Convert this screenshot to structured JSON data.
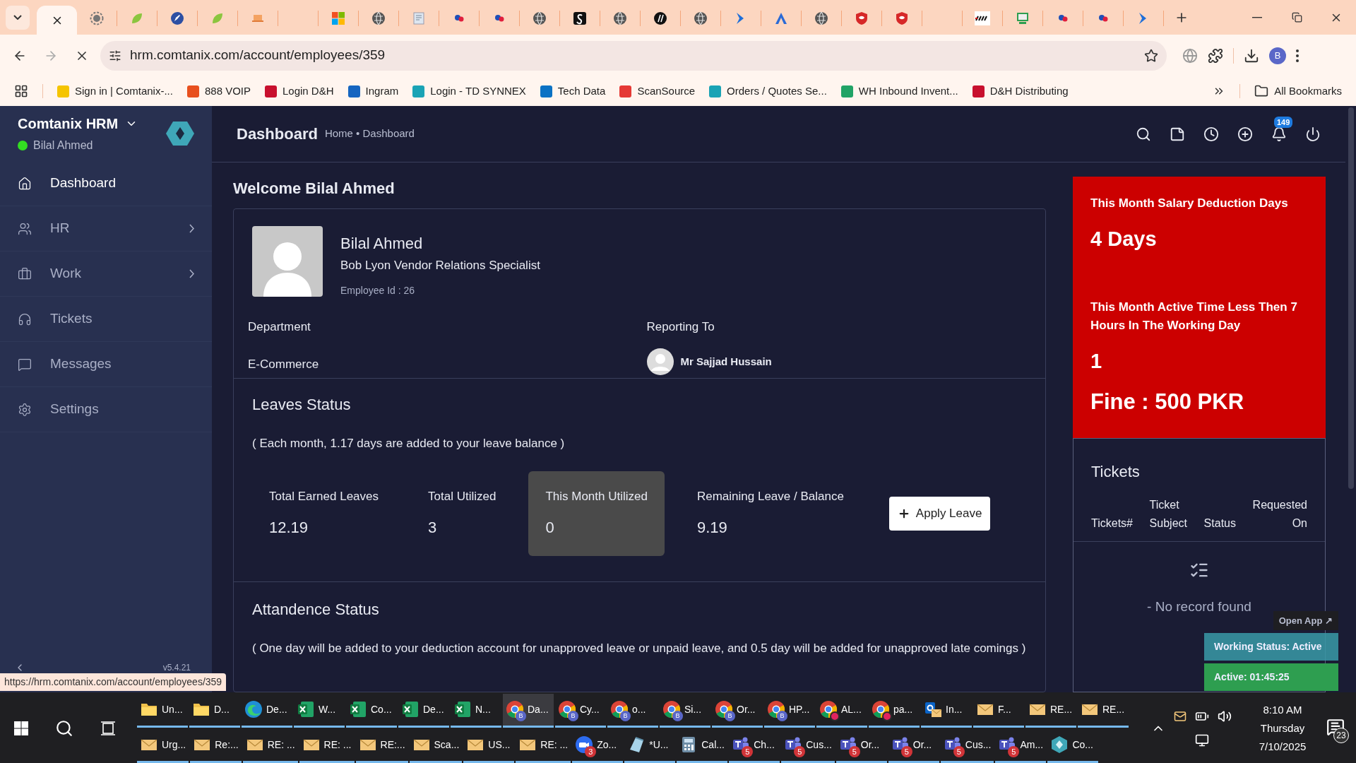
{
  "browser": {
    "tabs": [
      {
        "selected": true
      },
      {
        "kind": "ring",
        "selected": false
      },
      {
        "kind": "leaf",
        "selected": false
      },
      {
        "kind": "rocket",
        "selected": false
      },
      {
        "kind": "leaf",
        "selected": false
      },
      {
        "kind": "laptop",
        "selected": false
      },
      {
        "kind": "blank",
        "selected": false
      },
      {
        "kind": "windows",
        "selected": false
      },
      {
        "kind": "globe",
        "selected": false
      },
      {
        "kind": "doc",
        "selected": false
      },
      {
        "kind": "dots",
        "selected": false
      },
      {
        "kind": "dots",
        "selected": false
      },
      {
        "kind": "globe",
        "selected": false
      },
      {
        "kind": "blackbox",
        "selected": false
      },
      {
        "kind": "globe",
        "selected": false
      },
      {
        "kind": "blackcircle",
        "selected": false
      },
      {
        "kind": "globe",
        "selected": false
      },
      {
        "kind": "chevron",
        "selected": false
      },
      {
        "kind": "triangle",
        "selected": false
      },
      {
        "kind": "globe",
        "selected": false
      },
      {
        "kind": "shield",
        "selected": false
      },
      {
        "kind": "shield",
        "selected": false
      },
      {
        "kind": "blank",
        "selected": false
      },
      {
        "kind": "stripe",
        "selected": false
      },
      {
        "kind": "monitor",
        "selected": false
      },
      {
        "kind": "dots",
        "selected": false
      },
      {
        "kind": "dots",
        "selected": false
      },
      {
        "kind": "chevron",
        "selected": false
      }
    ],
    "address": "hrm.comtanix.com/account/employees/359",
    "profile": "B",
    "bookmarks": [
      {
        "label": "Sign in | Comtanix-...",
        "color": "#f5c400"
      },
      {
        "label": "888 VOIP",
        "color": "#e8501e"
      },
      {
        "label": "Login D&H",
        "color": "#c8102e"
      },
      {
        "label": "Ingram",
        "color": "#1565c0"
      },
      {
        "label": "Login - TD SYNNEX",
        "color": "#1aa3b5"
      },
      {
        "label": "Tech Data",
        "color": "#0b72c4"
      },
      {
        "label": "ScanSource",
        "color": "#e53935"
      },
      {
        "label": "Orders / Quotes Se...",
        "color": "#1aa3b5"
      },
      {
        "label": "WH Inbound Invent...",
        "color": "#21a366"
      },
      {
        "label": "D&H Distributing",
        "color": "#c8102e"
      }
    ],
    "all_bookmarks": "All Bookmarks",
    "status_url": "https://hrm.comtanix.com/account/employees/359"
  },
  "app": {
    "brand": "Comtanix HRM",
    "user": "Bilal Ahmed",
    "user_online": true,
    "nav": [
      {
        "label": "Dashboard",
        "kind": "home",
        "selected": true,
        "expandable": false
      },
      {
        "label": "HR",
        "kind": "users",
        "selected": false,
        "expandable": true
      },
      {
        "label": "Work",
        "kind": "briefcase",
        "selected": false,
        "expandable": true
      },
      {
        "label": "Tickets",
        "kind": "headphones",
        "selected": false,
        "expandable": false
      },
      {
        "label": "Messages",
        "kind": "message",
        "selected": false,
        "expandable": false
      },
      {
        "label": "Settings",
        "kind": "settings",
        "selected": false,
        "expandable": false
      }
    ],
    "version": "v5.4.21",
    "header": {
      "title": "Dashboard",
      "breadcrumb": "Home • Dashboard",
      "notifications": "149"
    },
    "welcome": "Welcome Bilal Ahmed",
    "profile": {
      "name": "Bilal Ahmed",
      "title": "Bob Lyon Vendor Relations Specialist",
      "employee_id": "Employee Id : 26",
      "department_label": "Department",
      "department": "E-Commerce",
      "reporting_label": "Reporting To",
      "reporting_to": "Mr Sajjad Hussain"
    },
    "leaves": {
      "title": "Leaves Status",
      "note": "( Each month, 1.17 days are added to your leave balance )",
      "stats": [
        {
          "label": "Total Earned Leaves",
          "value": "12.19",
          "selected": false
        },
        {
          "label": "Total Utilized",
          "value": "3",
          "selected": false
        },
        {
          "label": "This Month Utilized",
          "value": "0",
          "selected": true
        },
        {
          "label": "Remaining Leave / Balance",
          "value": "9.19",
          "selected": false
        }
      ],
      "button": "Apply Leave"
    },
    "attendance": {
      "title": "Attandence Status",
      "note": "( One day will be added to your deduction account for unapproved leave or unpaid leave, and 0.5 day will be added for unapproved late comings )"
    },
    "deduction": {
      "days_label": "This Month Salary Deduction Days",
      "days": "4 Days",
      "active_label": "This Month Active Time Less Then 7 Hours In The Working Day",
      "active_count": "1",
      "fine": "Fine : 500 PKR"
    },
    "tickets": {
      "title": "Tickets",
      "columns": [
        [
          "",
          "Tickets#"
        ],
        [
          "Ticket",
          "Subject"
        ],
        [
          "",
          "Status"
        ],
        [
          "Requested",
          "On"
        ]
      ],
      "empty": "- No record found"
    },
    "widget": {
      "open_app": "Open App ↗",
      "status": "Working Status: Active",
      "timer": "Active: 01:45:25"
    }
  },
  "taskbar": {
    "rows": [
      [
        {
          "label": "Un...",
          "kind": "folder",
          "selected": false
        },
        {
          "label": "D...",
          "kind": "folder",
          "selected": false
        },
        {
          "label": "De...",
          "kind": "edge",
          "selected": false
        },
        {
          "label": "W...",
          "kind": "excel",
          "selected": false
        },
        {
          "label": "Co...",
          "kind": "excel",
          "selected": false
        },
        {
          "label": "De...",
          "kind": "excel",
          "selected": false
        },
        {
          "label": "N...",
          "kind": "excel",
          "selected": false
        },
        {
          "label": "Da...",
          "kind": "chrome",
          "profile": "B",
          "selected": true
        },
        {
          "label": "Cy...",
          "kind": "chrome",
          "profile": "B",
          "selected": false
        },
        {
          "label": "o...",
          "kind": "chrome",
          "profile": "B",
          "selected": false
        },
        {
          "label": "Si...",
          "kind": "chrome",
          "profile": "B",
          "selected": false
        },
        {
          "label": "Or...",
          "kind": "chrome",
          "profile": "B",
          "selected": false
        },
        {
          "label": "HP...",
          "kind": "chrome",
          "profile": "B",
          "selected": false
        },
        {
          "label": "AL...",
          "kind": "chrome",
          "selected": false
        },
        {
          "label": "pa...",
          "kind": "chrome",
          "selected": false
        },
        {
          "label": "In...",
          "kind": "outlook",
          "selected": false
        },
        {
          "label": "F...",
          "kind": "mail",
          "selected": false
        },
        {
          "label": "RE...",
          "kind": "mail",
          "selected": false
        },
        {
          "label": "RE...",
          "kind": "mail",
          "selected": false
        }
      ],
      [
        {
          "label": "Urg...",
          "kind": "mail",
          "selected": false
        },
        {
          "label": "Re:...",
          "kind": "mail",
          "selected": false
        },
        {
          "label": "RE: ...",
          "kind": "mail",
          "selected": false
        },
        {
          "label": "RE: ...",
          "kind": "mail",
          "selected": false
        },
        {
          "label": "RE:...",
          "kind": "mail",
          "selected": false
        },
        {
          "label": "Sca...",
          "kind": "mail",
          "selected": false
        },
        {
          "label": "US...",
          "kind": "mail",
          "selected": false
        },
        {
          "label": "RE: ...",
          "kind": "mail",
          "selected": false
        },
        {
          "label": "Zo...",
          "kind": "zoom",
          "badge": "3",
          "selected": false
        },
        {
          "label": "*U...",
          "kind": "notepad",
          "selected": false
        },
        {
          "label": "Cal...",
          "kind": "calc",
          "selected": false
        },
        {
          "label": "Ch...",
          "kind": "teams",
          "badge": "5",
          "selected": false
        },
        {
          "label": "Cus...",
          "kind": "teams",
          "badge": "5",
          "selected": false
        },
        {
          "label": "Or...",
          "kind": "teams",
          "badge": "5",
          "selected": false
        },
        {
          "label": "Or...",
          "kind": "teams",
          "badge": "5",
          "selected": false
        },
        {
          "label": "Cus...",
          "kind": "teams",
          "badge": "5",
          "selected": false
        },
        {
          "label": "Am...",
          "kind": "teams",
          "badge": "5",
          "selected": false
        },
        {
          "label": "Co...",
          "kind": "app",
          "selected": false
        }
      ]
    ],
    "time": "8:10 AM",
    "day": "Thursday",
    "date": "7/10/2025",
    "notifications": "23"
  }
}
